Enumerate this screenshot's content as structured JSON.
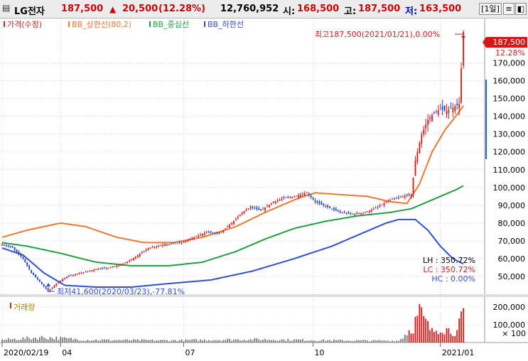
{
  "header": {
    "stock_name": "LG전자",
    "price": "187,500",
    "change_arrow": "▲",
    "change": "20,500",
    "change_pct": "(12.28%)",
    "volume": "12,760,952",
    "open_label": "시:",
    "open": "168,500",
    "high_label": "고:",
    "high": "187,500",
    "low_label": "저:",
    "low": "163,500",
    "period_button": "1일",
    "colors": {
      "up": "#d00000",
      "down": "#0000cc"
    }
  },
  "legend": [
    {
      "label": "가격(수정)",
      "color": "#d02020"
    },
    {
      "label": "BB_상한선(80,2)",
      "color": "#f07830"
    },
    {
      "label": "BB_중심선",
      "color": "#20a040"
    },
    {
      "label": "BB_하한선",
      "color": "#3050d0"
    }
  ],
  "annotations": {
    "high": "최고187,500(2021/01/21),0.00%",
    "low": "최저41,600(2020/03/23),-77.81%",
    "last_price": "187,500",
    "last_pct": "12.28%",
    "lh": "LH : 350.72%",
    "lc": "LC : 350.72%",
    "hc": "HC :   0.00%"
  },
  "volume_panel": {
    "label": "거래량",
    "unit": "× 100",
    "ticks": [
      "200,000",
      "100,000"
    ]
  },
  "chart_data": {
    "type": "candlestick",
    "price_axis": {
      "ticks": [
        "170,000",
        "160,000",
        "150,000",
        "140,000",
        "130,000",
        "120,000",
        "110,000",
        "100,000",
        "90,000",
        "80,000",
        "70,000",
        "60,000",
        "50,000"
      ],
      "ylim": [
        40000,
        195000
      ]
    },
    "x_labels": [
      {
        "label": "2020/02/19",
        "index": 0
      },
      {
        "label": "04",
        "index": 28
      },
      {
        "label": "07",
        "index": 87
      },
      {
        "label": "10",
        "index": 149
      },
      {
        "label": "2021/01",
        "index": 210
      }
    ],
    "n_days": 222,
    "price_anchors": [
      [
        0,
        68000
      ],
      [
        5,
        66000
      ],
      [
        10,
        60000
      ],
      [
        14,
        52000
      ],
      [
        18,
        47000
      ],
      [
        22,
        41600
      ],
      [
        26,
        46000
      ],
      [
        31,
        50000
      ],
      [
        38,
        52000
      ],
      [
        45,
        54000
      ],
      [
        52,
        55000
      ],
      [
        58,
        57000
      ],
      [
        64,
        61000
      ],
      [
        70,
        66000
      ],
      [
        78,
        68000
      ],
      [
        86,
        69000
      ],
      [
        92,
        72000
      ],
      [
        98,
        75000
      ],
      [
        104,
        74000
      ],
      [
        110,
        80000
      ],
      [
        115,
        86000
      ],
      [
        119,
        89000
      ],
      [
        124,
        87000
      ],
      [
        130,
        92000
      ],
      [
        135,
        94000
      ],
      [
        140,
        95000
      ],
      [
        146,
        97000
      ],
      [
        150,
        92000
      ],
      [
        156,
        89000
      ],
      [
        162,
        86000
      ],
      [
        168,
        85000
      ],
      [
        174,
        86000
      ],
      [
        180,
        89000
      ],
      [
        186,
        93000
      ],
      [
        192,
        95000
      ],
      [
        196,
        96000
      ],
      [
        198,
        115000
      ],
      [
        201,
        130000
      ],
      [
        204,
        138000
      ],
      [
        207,
        142000
      ],
      [
        210,
        144000
      ],
      [
        213,
        143000
      ],
      [
        216,
        145000
      ],
      [
        219,
        147000
      ],
      [
        220,
        167000
      ],
      [
        221,
        187500
      ]
    ],
    "bb_upper_anchors": [
      [
        0,
        72000
      ],
      [
        12,
        76000
      ],
      [
        28,
        80000
      ],
      [
        40,
        78000
      ],
      [
        55,
        72000
      ],
      [
        68,
        69000
      ],
      [
        82,
        69000
      ],
      [
        96,
        72000
      ],
      [
        112,
        78000
      ],
      [
        126,
        86000
      ],
      [
        142,
        94000
      ],
      [
        150,
        97000
      ],
      [
        162,
        96000
      ],
      [
        175,
        95000
      ],
      [
        186,
        92000
      ],
      [
        194,
        91000
      ],
      [
        200,
        102000
      ],
      [
        206,
        120000
      ],
      [
        212,
        132000
      ],
      [
        218,
        141000
      ],
      [
        221,
        146000
      ]
    ],
    "bb_middle_anchors": [
      [
        0,
        69000
      ],
      [
        12,
        67000
      ],
      [
        28,
        63000
      ],
      [
        45,
        58000
      ],
      [
        62,
        56000
      ],
      [
        80,
        56000
      ],
      [
        96,
        58000
      ],
      [
        112,
        64000
      ],
      [
        126,
        71000
      ],
      [
        140,
        77000
      ],
      [
        155,
        81000
      ],
      [
        170,
        84000
      ],
      [
        186,
        86000
      ],
      [
        196,
        88000
      ],
      [
        204,
        92000
      ],
      [
        212,
        96000
      ],
      [
        218,
        99000
      ],
      [
        221,
        101000
      ]
    ],
    "bb_lower_anchors": [
      [
        0,
        66000
      ],
      [
        10,
        62000
      ],
      [
        20,
        52000
      ],
      [
        30,
        45000
      ],
      [
        45,
        44000
      ],
      [
        62,
        44000
      ],
      [
        80,
        46000
      ],
      [
        100,
        48000
      ],
      [
        120,
        53000
      ],
      [
        140,
        60000
      ],
      [
        158,
        67000
      ],
      [
        172,
        74000
      ],
      [
        184,
        80000
      ],
      [
        190,
        82000
      ],
      [
        198,
        82000
      ],
      [
        204,
        76000
      ],
      [
        210,
        67000
      ],
      [
        216,
        60000
      ],
      [
        221,
        57000
      ]
    ],
    "volume_anchors": [
      [
        0,
        15000
      ],
      [
        20,
        30000
      ],
      [
        40,
        15000
      ],
      [
        80,
        12000
      ],
      [
        120,
        18000
      ],
      [
        160,
        12000
      ],
      [
        190,
        10000
      ],
      [
        197,
        90000
      ],
      [
        200,
        170000
      ],
      [
        203,
        110000
      ],
      [
        206,
        60000
      ],
      [
        210,
        90000
      ],
      [
        214,
        70000
      ],
      [
        218,
        60000
      ],
      [
        220,
        130000
      ],
      [
        221,
        150000
      ]
    ],
    "volume_ylim": [
      0,
      240000
    ]
  }
}
